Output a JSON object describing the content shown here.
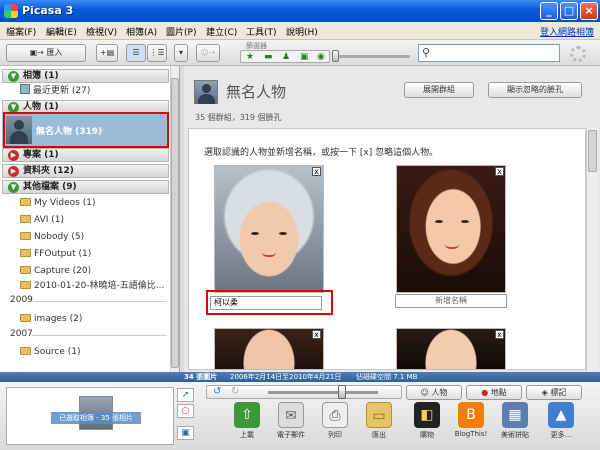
{
  "window": {
    "title": "Picasa 3"
  },
  "menu": {
    "items": [
      "檔案(F)",
      "編輯(E)",
      "檢視(V)",
      "相簿(A)",
      "圖片(P)",
      "建立(C)",
      "工具(T)",
      "說明(H)"
    ],
    "signin": "登入網路相簿"
  },
  "toolbar": {
    "import_label": "匯入",
    "filter_label": "篩選器",
    "search_placeholder": ""
  },
  "sidebar": {
    "albums": "相簿 (1)",
    "recent": "最近更新 (27)",
    "people": "人物 (1)",
    "unnamed_people": "無名人物 (319)",
    "projects": "專案 (1)",
    "folders": "資料夾 (12)",
    "other_folders": "其他檔案 (9)",
    "folder_items": [
      "My Videos (1)",
      "AVI (1)",
      "Nobody (5)",
      "FFOutput (1)",
      "Capture (20)",
      "2010-01-20-林曉培-五語倫比..."
    ],
    "year_2009": "2009",
    "images_item": "images (2)",
    "year_2007": "2007",
    "source_item": "Source (1)"
  },
  "main": {
    "title": "無名人物",
    "expand_button": "展開群組",
    "show_ignored_button": "顯示忽略的臉孔",
    "subtitle": "35 個群組，319 個臉孔",
    "instruction": "選取認識的人物並新增名稱，或按一下 [x] 忽略這個人物。",
    "face1_name": "柯以柔",
    "face2_placeholder": "新增名稱",
    "close_glyph": "x"
  },
  "status": {
    "count": "34 張圖片",
    "date_range": "2006年2月14日至2010年4月21日",
    "disk": "佔磁碟空間 7.1 MB"
  },
  "tray": {
    "label": "已選取相簿 - 35 張相片"
  },
  "bottom": {
    "people_button": "人物",
    "places_button": "地點",
    "tags_button": "標記",
    "actions": [
      "上載",
      "電子郵件",
      "列印",
      "匯出",
      "購物",
      "BlogThis!",
      "美術拼貼",
      "更多..."
    ]
  }
}
